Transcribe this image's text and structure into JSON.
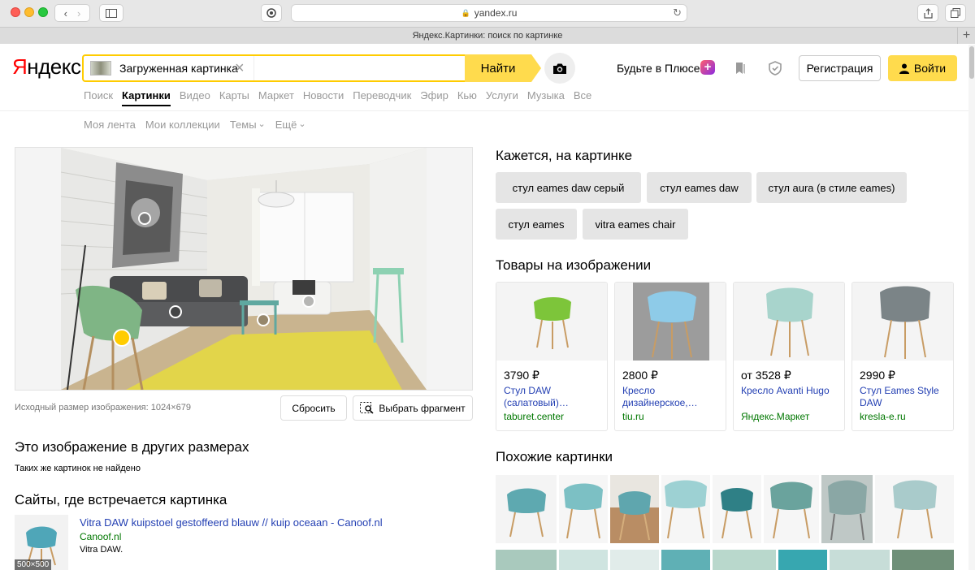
{
  "browser": {
    "address": "yandex.ru",
    "tab_title": "Яндекс.Картинки: поиск по картинке"
  },
  "header": {
    "logo_first": "Я",
    "logo_rest": "ндекс",
    "search_query": "Загруженная картинка",
    "find_button": "Найти",
    "plus_text": "Будьте в Плюсе",
    "register_button": "Регистрация",
    "login_button": "Войти"
  },
  "nav": {
    "items": [
      "Поиск",
      "Картинки",
      "Видео",
      "Карты",
      "Маркет",
      "Новости",
      "Переводчик",
      "Эфир",
      "Кью",
      "Услуги",
      "Музыка",
      "Все"
    ],
    "active_index": 1
  },
  "subnav": {
    "items": [
      "Моя лента",
      "Мои коллекции",
      "Темы",
      "Ещё"
    ]
  },
  "image_panel": {
    "source_size": "Исходный размер изображения: 1024×679",
    "reset_button": "Сбросить",
    "fragment_button": "Выбрать фрагмент"
  },
  "other_sizes": {
    "title": "Это изображение в других размерах",
    "none_found": "Таких же картинок не найдено"
  },
  "sites": {
    "title": "Сайты, где встречается картинка",
    "items": [
      {
        "link": "Vitra DAW kuipstoel gestoffeerd blauw // kuip oceaan - Canoof.nl",
        "domain": "Canoof.nl",
        "desc": "Vitra DAW.",
        "thumb_size": "500×500"
      }
    ]
  },
  "seems_like": {
    "title": "Кажется, на картинке",
    "tags": [
      "стул eames daw серый",
      "стул eames daw",
      "стул aura (в стиле eames)",
      "стул eames",
      "vitra eames chair"
    ]
  },
  "products": {
    "title": "Товары на изображении",
    "items": [
      {
        "price": "3790 ₽",
        "name": "Стул DAW (салатовый)…",
        "shop": "taburet.center",
        "color": "#7dc53a"
      },
      {
        "price": "2800 ₽",
        "name": "Кресло дизайнерское,…",
        "shop": "tiu.ru",
        "color": "#8ecbe8"
      },
      {
        "price": "от 3528 ₽",
        "name": "Кресло Avanti Hugo",
        "shop": "Яндекс.Маркет",
        "color": "#a8d4cc"
      },
      {
        "price": "2990 ₽",
        "name": "Стул Eames Style DAW",
        "shop": "kresla-e.ru",
        "color": "#7b8487"
      }
    ]
  },
  "similar": {
    "title": "Похожие картинки"
  }
}
